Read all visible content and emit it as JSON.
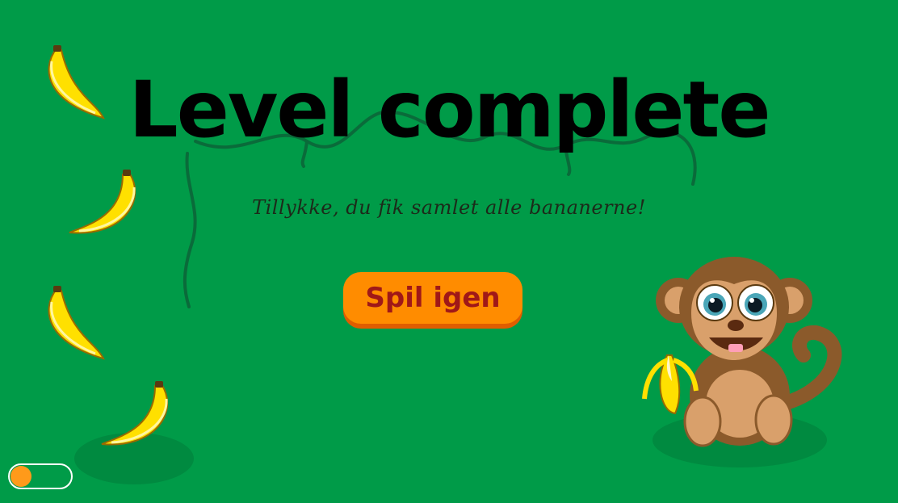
{
  "screen": {
    "title": "Level complete",
    "subtitle": "Tillykke, du fik samlet alle bananerne!",
    "play_again_label": "Spil igen"
  },
  "colors": {
    "background": "#009b48",
    "button": "#ff8c00",
    "button_text": "#a01818",
    "vine": "#0a6b3a",
    "banana": "#ffe000",
    "monkey_fur": "#8b5a2b",
    "monkey_face": "#d9a06b",
    "toggle_knob": "#ff9a1a"
  },
  "bananas_collected": 4,
  "sound_toggle": {
    "on": false
  }
}
